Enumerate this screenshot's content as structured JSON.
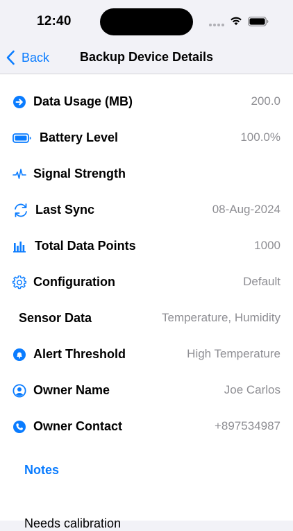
{
  "status_bar": {
    "time": "12:40"
  },
  "nav": {
    "back_label": "Back",
    "title": "Backup Device Details"
  },
  "rows": [
    {
      "label": "Data Usage (MB)",
      "value": "200.0",
      "icon": "arrow-right-circle-icon"
    },
    {
      "label": "Battery Level",
      "value": "100.0%",
      "icon": "battery-icon"
    },
    {
      "label": "Signal Strength",
      "value": "",
      "icon": "waveform-icon"
    },
    {
      "label": "Last Sync",
      "value": "08-Aug-2024",
      "icon": "sync-icon"
    },
    {
      "label": "Total Data Points",
      "value": "1000",
      "icon": "bar-chart-icon"
    },
    {
      "label": "Configuration",
      "value": "Default",
      "icon": "gear-icon"
    },
    {
      "label": "Sensor Data",
      "value": "Temperature, Humidity",
      "icon": ""
    },
    {
      "label": "Alert Threshold",
      "value": "High Temperature",
      "icon": "bell-icon"
    },
    {
      "label": "Owner Name",
      "value": "Joe Carlos",
      "icon": "person-circle-icon"
    },
    {
      "label": "Owner Contact",
      "value": "+897534987",
      "icon": "phone-icon"
    }
  ],
  "notes": {
    "label": "Notes",
    "text": "Needs calibration"
  },
  "colors": {
    "accent": "#0a7cff",
    "secondary_text": "#8e8e93"
  }
}
